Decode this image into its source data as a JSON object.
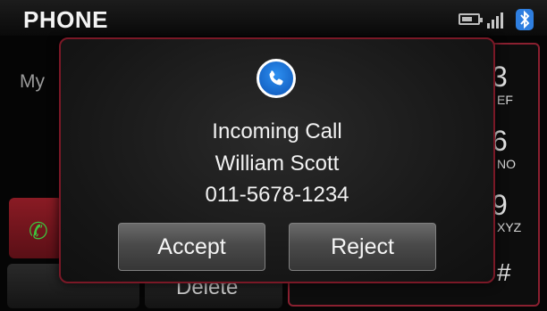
{
  "header": {
    "title": "PHONE"
  },
  "background": {
    "label": "My",
    "keypad": [
      {
        "num": "3",
        "letters": "EF"
      },
      {
        "num": "6",
        "letters": "NO"
      },
      {
        "num": "9",
        "letters": "XYZ"
      },
      {
        "num": "#",
        "letters": ""
      }
    ],
    "delete_label": "Delete"
  },
  "popup": {
    "heading": "Incoming Call",
    "caller_name": "William Scott",
    "caller_number": "011-5678-1234",
    "accept_label": "Accept",
    "reject_label": "Reject"
  },
  "colors": {
    "accent_blue": "#2f7fe0",
    "frame_red": "#7a1826",
    "call_green": "#3ec43e"
  }
}
